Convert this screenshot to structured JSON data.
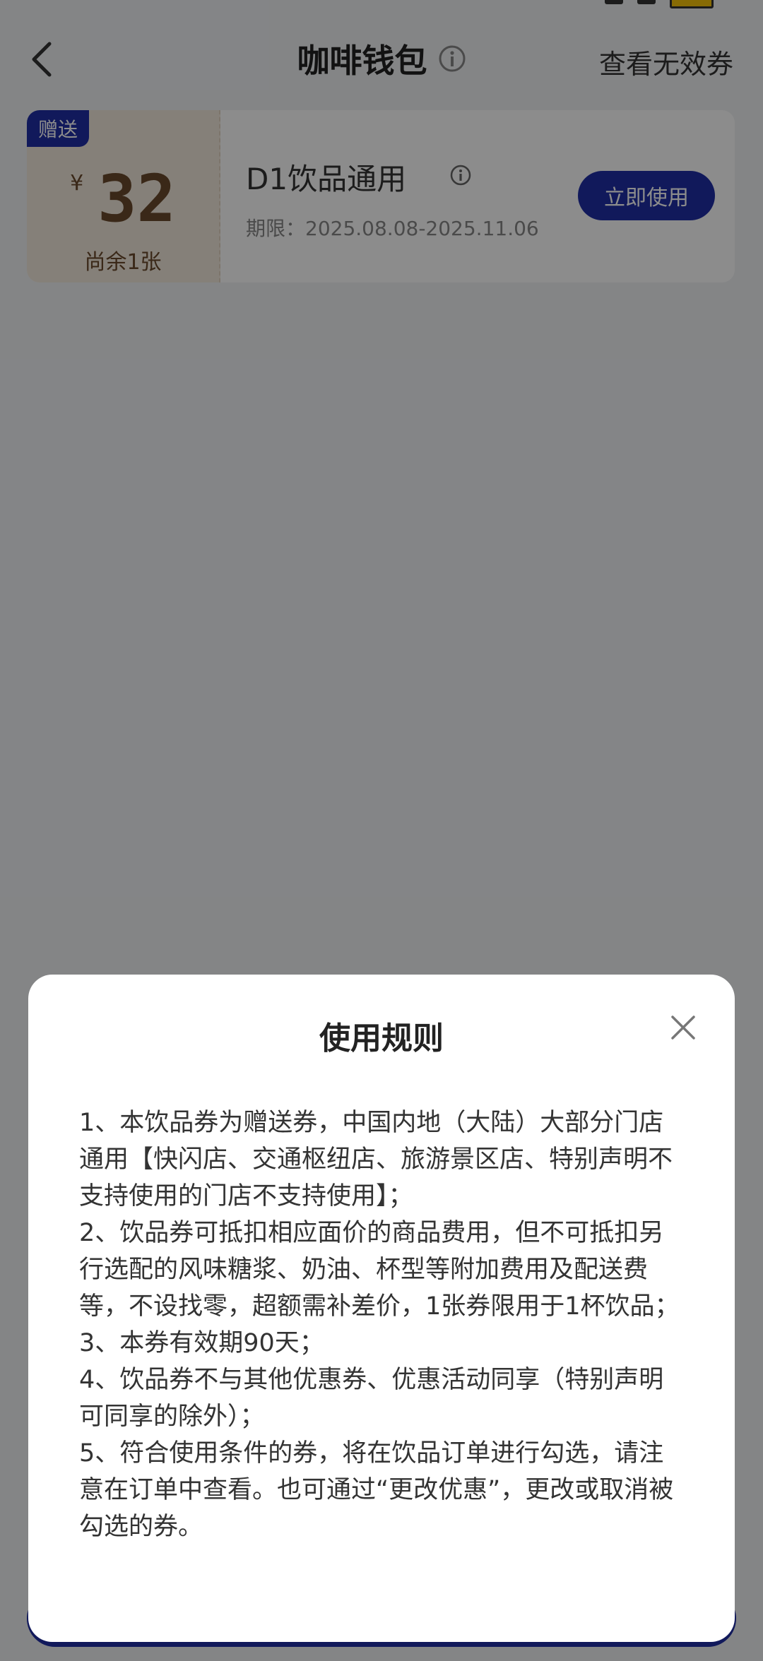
{
  "nav": {
    "title": "咖啡钱包",
    "right_link": "查看无效券"
  },
  "coupon": {
    "badge": "赠送",
    "currency": "¥",
    "amount": "32",
    "remaining": "尚余1张",
    "name": "D1饮品通用",
    "period": "期限：2025.08.08-2025.11.06",
    "action": "立即使用"
  },
  "modal": {
    "title": "使用规则",
    "rules": [
      "1、本饮品券为赠送券，中国内地（大陆）大部分门店通用【快闪店、交通枢纽店、旅游景区店、特别声明不支持使用的门店不支持使用】；",
      "2、饮品券可抵扣相应面价的商品费用，但不可抵扣另行选配的风味糖浆、奶油、杯型等附加费用及配送费等，不设找零，超额需补差价，1张券限用于1杯饮品；",
      "3、本券有效期90天；",
      "4、饮品券不与其他优惠券、优惠活动同享（特别声明可同享的除外）；",
      "5、符合使用条件的券，将在饮品订单进行勾选，请注意在订单中查看。也可通过“更改优惠”，更改或取消被勾选的券。"
    ]
  },
  "colors": {
    "brand": "#1f2fa6",
    "coupon_left_bg": "#f3e9dc",
    "coupon_amount": "#6a4a2c"
  },
  "icons": {
    "back": "back-arrow-icon",
    "info": "info-icon",
    "close": "close-icon"
  }
}
